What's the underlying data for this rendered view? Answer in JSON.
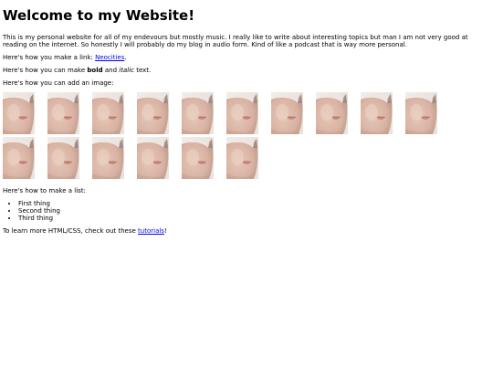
{
  "heading": "Welcome to my Website!",
  "intro": "This is my personal website for all of my endevours but mostly music. I really like to write about interesting topics but man I am not very good at reading on the internet. So honestly I will probably do my blog in audio form. Kind of like a podcast that is way more personal.",
  "link_section": {
    "prefix": "Here's how you make a link: ",
    "link_text": "Neocities",
    "suffix": "."
  },
  "format_section": {
    "prefix": "Here's how you can make ",
    "bold": "bold",
    "middle": " and ",
    "italic": "italic",
    "suffix": " text."
  },
  "image_section": {
    "text": "Here's how you can add an image:",
    "image_count": 16,
    "icon": "face-photo-thumbnail"
  },
  "list_section": {
    "text": "Here's how to make a list:",
    "items": [
      "First thing",
      "Second thing",
      "Third thing"
    ]
  },
  "footer": {
    "prefix": "To learn more HTML/CSS, check out these ",
    "link_text": "tutorials",
    "suffix": "!"
  }
}
